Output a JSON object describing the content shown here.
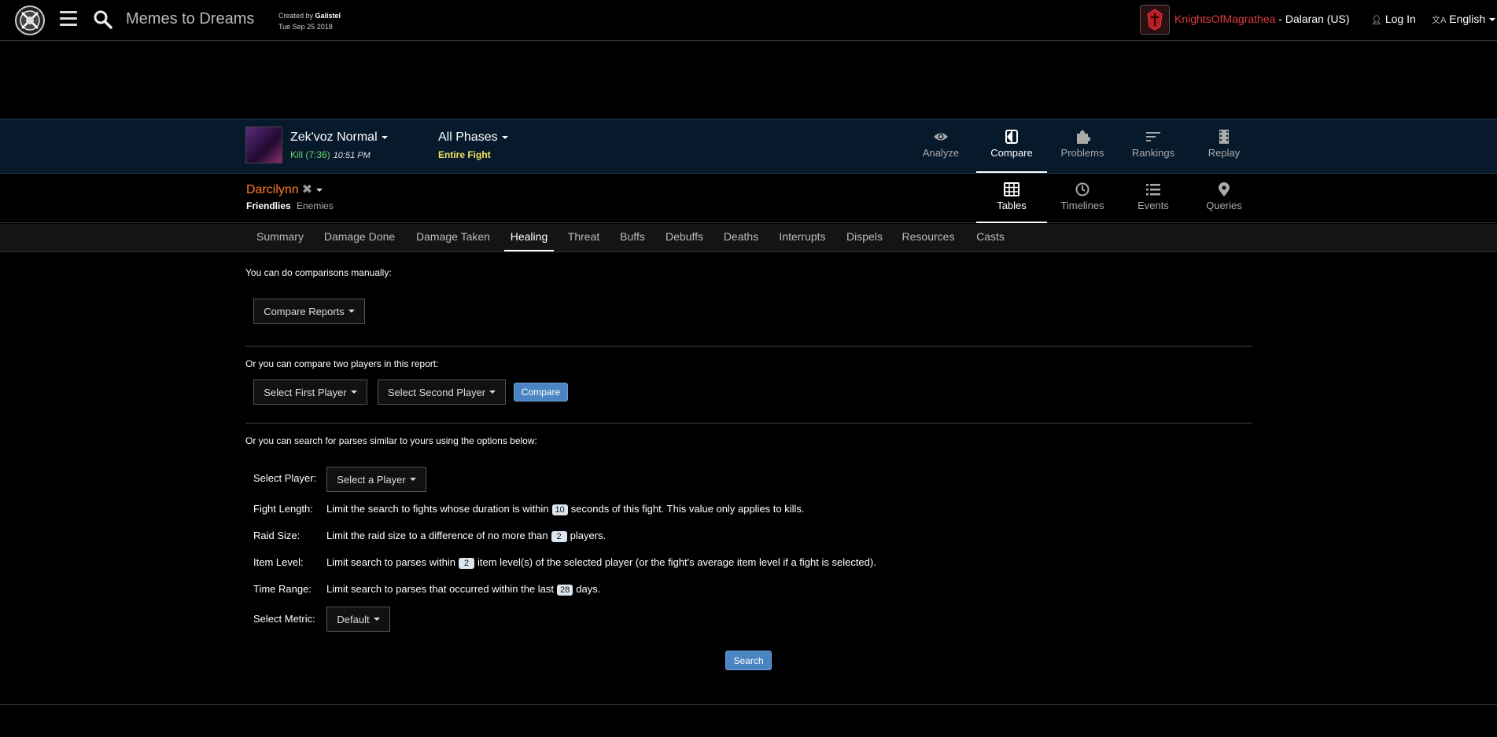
{
  "header": {
    "report_title": "Memes to Dreams",
    "created_by_label": "Created by",
    "created_by_name": "Galistel",
    "created_date": "Tue Sep 25 2018",
    "guild_name": "KnightsOfMagrathea",
    "realm": " - Dalaran (US)",
    "login_label": "Log In",
    "language": "English"
  },
  "fight": {
    "boss": "Zek'voz Normal",
    "result": "Kill (7:36)",
    "time": "10:51 PM",
    "phases": "All Phases",
    "phase_sub": "Entire Fight"
  },
  "view_tabs": [
    {
      "label": "Analyze",
      "icon": "eye-icon"
    },
    {
      "label": "Compare",
      "icon": "compare-icon",
      "active": true
    },
    {
      "label": "Problems",
      "icon": "puzzle-icon"
    },
    {
      "label": "Rankings",
      "icon": "rankings-icon"
    },
    {
      "label": "Replay",
      "icon": "film-icon"
    }
  ],
  "player": {
    "name": "Darcilynn",
    "friendlies": "Friendlies",
    "enemies": "Enemies"
  },
  "mode_tabs": [
    {
      "label": "Tables",
      "icon": "table-icon",
      "active": true
    },
    {
      "label": "Timelines",
      "icon": "clock-icon"
    },
    {
      "label": "Events",
      "icon": "list-icon"
    },
    {
      "label": "Queries",
      "icon": "pin-icon"
    }
  ],
  "category_tabs": [
    "Summary",
    "Damage Done",
    "Damage Taken",
    "Healing",
    "Threat",
    "Buffs",
    "Debuffs",
    "Deaths",
    "Interrupts",
    "Dispels",
    "Resources",
    "Casts"
  ],
  "active_category": "Healing",
  "content": {
    "manual_text": "You can do comparisons manually:",
    "compare_reports": "Compare Reports",
    "two_players_text": "Or you can compare two players in this report:",
    "first_player": "Select First Player",
    "second_player": "Select Second Player",
    "compare_btn": "Compare",
    "parses_text": "Or you can search for parses similar to yours using the options below:",
    "select_player_label": "Select Player:",
    "select_player_btn": "Select a Player",
    "fight_length_label": "Fight Length:",
    "fight_length_pre": "Limit the search to fights whose duration is within",
    "fight_length_value": "10",
    "fight_length_post": "seconds of this fight. This value only applies to kills.",
    "raid_size_label": "Raid Size:",
    "raid_size_pre": "Limit the raid size to a difference of no more than",
    "raid_size_value": "2",
    "raid_size_post": "players.",
    "item_level_label": "Item Level:",
    "item_level_pre": "Limit search to parses within",
    "item_level_value": "2",
    "item_level_post": "item level(s) of the selected player (or the fight's average item level if a fight is selected).",
    "time_range_label": "Time Range:",
    "time_range_pre": "Limit search to parses that occurred within the last",
    "time_range_value": "28",
    "time_range_post": "days.",
    "metric_label": "Select Metric:",
    "metric_value": "Default",
    "search_btn": "Search"
  }
}
